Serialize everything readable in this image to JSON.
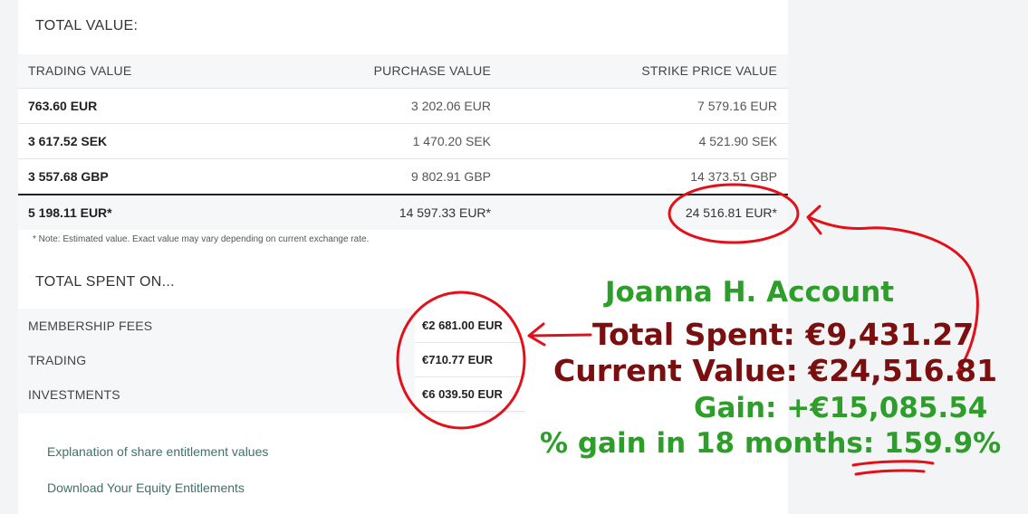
{
  "total_value": {
    "title": "TOTAL VALUE:",
    "headers": [
      "TRADING VALUE",
      "PURCHASE VALUE",
      "STRIKE PRICE VALUE"
    ],
    "rows": [
      [
        "763.60 EUR",
        "3 202.06 EUR",
        "7 579.16 EUR"
      ],
      [
        "3 617.52 SEK",
        "1 470.20 SEK",
        "4 521.90 SEK"
      ],
      [
        "3 557.68 GBP",
        "9 802.91 GBP",
        "14 373.51 GBP"
      ]
    ],
    "total": [
      "5 198.11 EUR*",
      "14 597.33 EUR*",
      "24 516.81 EUR*"
    ],
    "note": "* Note: Estimated value. Exact value may vary depending on current exchange rate."
  },
  "total_spent": {
    "title": "TOTAL SPENT ON...",
    "rows": [
      {
        "label": "MEMBERSHIP FEES",
        "value": "€2 681.00 EUR"
      },
      {
        "label": "TRADING",
        "value": "€710.77 EUR"
      },
      {
        "label": "INVESTMENTS",
        "value": "€6 039.50 EUR"
      }
    ]
  },
  "links": {
    "explanation": "Explanation of share entitlement values",
    "download": "Download Your Equity Entitlements"
  },
  "annotation": {
    "account": "Joanna H. Account",
    "total_spent": "Total Spent: €9,431.27",
    "current_value": "Current Value: €24,516.81",
    "gain": "Gain: +€15,085.54",
    "pct_prefix": "% gain in 18 months: ",
    "pct_value": "159.9%",
    "colors": {
      "green": "#2e9e2a",
      "maroon": "#7a0f0f",
      "red": "#e3101a"
    }
  }
}
